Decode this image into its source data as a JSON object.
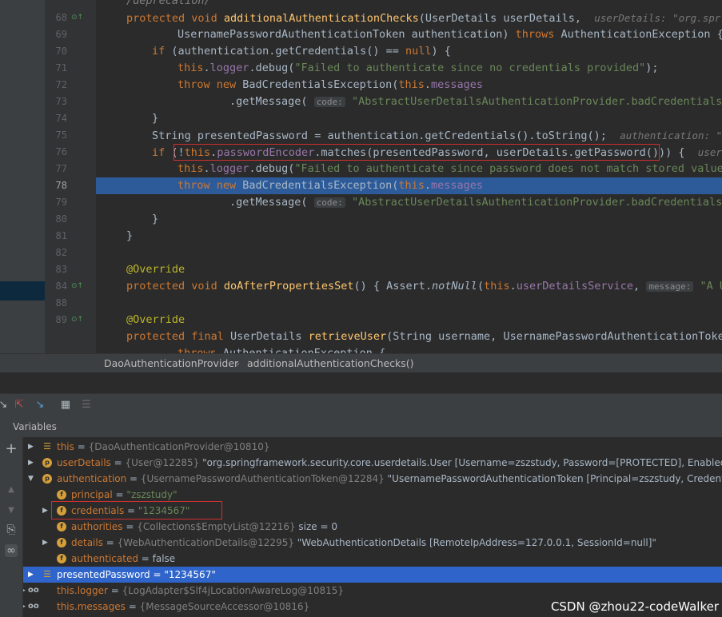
{
  "editor": {
    "lines": [
      {
        "num": "68",
        "icon": "override-method-icon"
      },
      {
        "num": "69"
      },
      {
        "num": "70"
      },
      {
        "num": "71"
      },
      {
        "num": "72"
      },
      {
        "num": "73"
      },
      {
        "num": "74"
      },
      {
        "num": "75"
      },
      {
        "num": "76"
      },
      {
        "num": "77"
      },
      {
        "num": "78",
        "current": true
      },
      {
        "num": "79"
      },
      {
        "num": "80"
      },
      {
        "num": "81"
      },
      {
        "num": "82"
      },
      {
        "num": "83"
      },
      {
        "num": "84",
        "icon": "override-method-icon"
      },
      {
        "num": "88"
      },
      {
        "num": "89",
        "icon": "override-method-icon"
      }
    ],
    "code": {
      "l67": "/deprecation/",
      "l68": [
        "protected void ",
        "additionalAuthenticationChecks",
        "(UserDetails userDetails,",
        "userDetails: \"org.spr"
      ],
      "l69": [
        "UsernamePasswordAuthenticationToken authentication) ",
        "throws ",
        "AuthenticationException {"
      ],
      "l70": [
        "if ",
        "(authentication.getCredentials() == ",
        "null",
        ") {"
      ],
      "l71": [
        "this",
        ".",
        "logger",
        ".debug(",
        "\"Failed to authenticate since no credentials provided\"",
        ");"
      ],
      "l72": [
        "throw new ",
        "BadCredentialsException(",
        "this",
        ".",
        "messages"
      ],
      "l73": [
        ".getMessage(",
        "code:",
        "\"AbstractUserDetailsAuthenticationProvider.badCredentials\","
      ],
      "l74": "}",
      "l75": [
        "String presentedPassword = authentication.getCredentials().toString();",
        "authentication: \""
      ],
      "l76": [
        "if ",
        "(!",
        "this",
        ".",
        "passwordEncoder",
        ".matches(presentedPassword, userDetails.getPassword())) {",
        "userD"
      ],
      "l77": [
        "this",
        ".",
        "logger",
        ".debug(",
        "\"Failed to authenticate since password does not match stored value\""
      ],
      "l78": [
        "throw new ",
        "BadCredentialsException(",
        "this",
        ".",
        "messages"
      ],
      "l79": [
        ".getMessage(",
        "code:",
        "\"AbstractUserDetailsAuthenticationProvider.badCredentials\","
      ],
      "l80": "}",
      "l81": "}",
      "l83": "@Override",
      "l84": [
        "protected void ",
        "doAfterPropertiesSet",
        "() { ",
        "Assert.",
        "notNull",
        "(",
        "this",
        ".",
        "userDetailsService",
        ", ",
        "message:",
        "\"A Us"
      ],
      "l88": "@Override",
      "l89": [
        "protected final ",
        "UserDetails ",
        "retrieveUser",
        "(String username, UsernamePasswordAuthenticationToken"
      ],
      "l90": [
        "throws ",
        "AuthenticationException {"
      ]
    }
  },
  "breadcrumb": {
    "class_name": "DaoAuthenticationProvider",
    "separator": "›",
    "method_name": "additionalAuthenticationChecks()"
  },
  "variables": {
    "header": "Variables",
    "rows": [
      {
        "name": "this",
        "rest": " = ",
        "ref": "{DaoAuthenticationProvider@10810}",
        "tail": "",
        "icon": "lines"
      },
      {
        "name": "userDetails",
        "rest": " = ",
        "ref": "{User@12285}",
        "tail": " \"org.springframework.security.core.userdetails.User [Username=zszstudy, Password=[PROTECTED], Enabled=true,",
        "icon": "p"
      },
      {
        "name": "authentication",
        "rest": " = ",
        "ref": "{UsernamePasswordAuthenticationToken@12284}",
        "tail": " \"UsernamePasswordAuthenticationToken [Principal=zszstudy, Credentials=[P",
        "icon": "p"
      },
      {
        "name": "principal",
        "rest": " = ",
        "ref": "",
        "tail": "\"zszstudy\"",
        "icon": "f"
      },
      {
        "name": "credentials",
        "rest": " = ",
        "ref": "",
        "tail": "\"1234567\"",
        "icon": "f"
      },
      {
        "name": "authorities",
        "rest": " = ",
        "ref": "{Collections$EmptyList@12216}",
        "tail": "  size = 0",
        "icon": "f"
      },
      {
        "name": "details",
        "rest": " = ",
        "ref": "{WebAuthenticationDetails@12295}",
        "tail": " \"WebAuthenticationDetails [RemoteIpAddress=127.0.0.1, SessionId=null]\"",
        "icon": "f"
      },
      {
        "name": "authenticated",
        "rest": " = ",
        "ref": "",
        "tail": "false",
        "icon": "f"
      },
      {
        "name": "presentedPassword",
        "rest": " = ",
        "ref": "",
        "tail": "\"1234567\"",
        "icon": "lines"
      },
      {
        "name": "this.logger",
        "rest": " = ",
        "ref": "{LogAdapter$Slf4jLocationAwareLog@10815}",
        "tail": "",
        "icon": "oo"
      },
      {
        "name": "this.messages",
        "rest": " = ",
        "ref": "{MessageSourceAccessor@10816}",
        "tail": "",
        "icon": "oo"
      }
    ]
  },
  "watermark": "CSDN @zhou22-codeWalker",
  "colors": {
    "selection": "#2f65ca",
    "current_line": "#2d5b9a",
    "highlight_box": "#d03030"
  }
}
